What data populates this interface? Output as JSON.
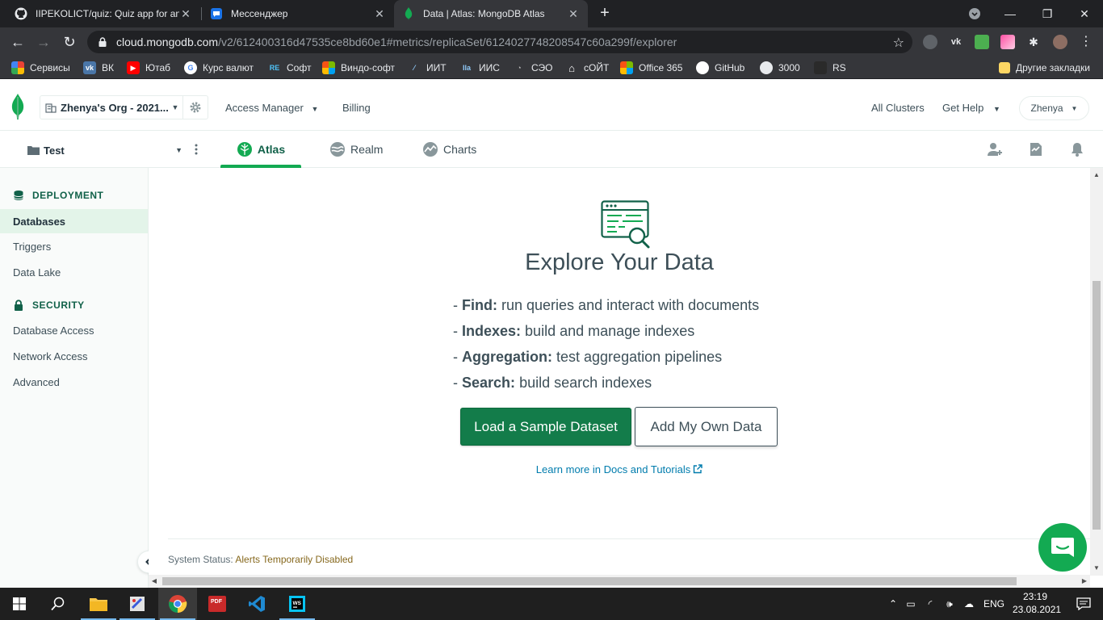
{
  "browser": {
    "tabs": [
      {
        "title": "IIPEKOLICT/quiz: Quiz app for an",
        "icon": "github-icon"
      },
      {
        "title": "Мессенджер",
        "icon": "messenger-icon"
      },
      {
        "title": "Data | Atlas: MongoDB Atlas",
        "icon": "mongodb-leaf-icon"
      }
    ],
    "url_host": "cloud.mongodb.com",
    "url_path": "/v2/612400316d47535ce8bd60e1#metrics/replicaSet/6124027748208547c60a299f/explorer",
    "bookmarks": [
      {
        "label": "Сервисы",
        "icon": "apps-grid-icon"
      },
      {
        "label": "ВК",
        "icon": "vk-icon"
      },
      {
        "label": "Ютаб",
        "icon": "youtube-icon"
      },
      {
        "label": "Курс валют",
        "icon": "google-icon"
      },
      {
        "label": "Софт",
        "icon": "re-icon"
      },
      {
        "label": "Виндо-софт",
        "icon": "windows-icon"
      },
      {
        "label": "ИИТ",
        "icon": "iit-icon"
      },
      {
        "label": "ИИС",
        "icon": "iis-icon"
      },
      {
        "label": "СЭО",
        "icon": "seo-icon"
      },
      {
        "label": "сОЙТ",
        "icon": "home-icon"
      },
      {
        "label": "Office 365",
        "icon": "office-icon"
      },
      {
        "label": "GitHub",
        "icon": "github-icon"
      },
      {
        "label": "3000",
        "icon": "globe-icon"
      },
      {
        "label": "RS",
        "icon": "rs-icon"
      }
    ],
    "other_bookmarks": "Другие закладки"
  },
  "atlas": {
    "org_name": "Zhenya's Org - 2021...",
    "nav": {
      "access_manager": "Access Manager",
      "billing": "Billing",
      "all_clusters": "All Clusters",
      "get_help": "Get Help",
      "user": "Zhenya"
    },
    "project": "Test",
    "project_tabs": [
      {
        "label": "Atlas",
        "active": true
      },
      {
        "label": "Realm",
        "active": false
      },
      {
        "label": "Charts",
        "active": false
      }
    ],
    "sidebar": {
      "deployment_heading": "DEPLOYMENT",
      "deployment_items": [
        "Databases",
        "Triggers",
        "Data Lake"
      ],
      "security_heading": "SECURITY",
      "security_items": [
        "Database Access",
        "Network Access",
        "Advanced"
      ]
    },
    "main": {
      "title": "Explore Your Data",
      "features": [
        {
          "name": "Find:",
          "desc": "run queries and interact with documents"
        },
        {
          "name": "Indexes:",
          "desc": "build and manage indexes"
        },
        {
          "name": "Aggregation:",
          "desc": "test aggregation pipelines"
        },
        {
          "name": "Search:",
          "desc": "build search indexes"
        }
      ],
      "primary_button": "Load a Sample Dataset",
      "secondary_button": "Add My Own Data",
      "learn_link": "Learn more in Docs and Tutorials",
      "status_label": "System Status:",
      "status_value": "Alerts Temporarily Disabled"
    }
  },
  "taskbar": {
    "lang": "ENG",
    "time": "23:19",
    "date": "23.08.2021"
  },
  "colors": {
    "brand_green": "#13aa52",
    "dark_green": "#116149",
    "link_blue": "#007cad"
  }
}
